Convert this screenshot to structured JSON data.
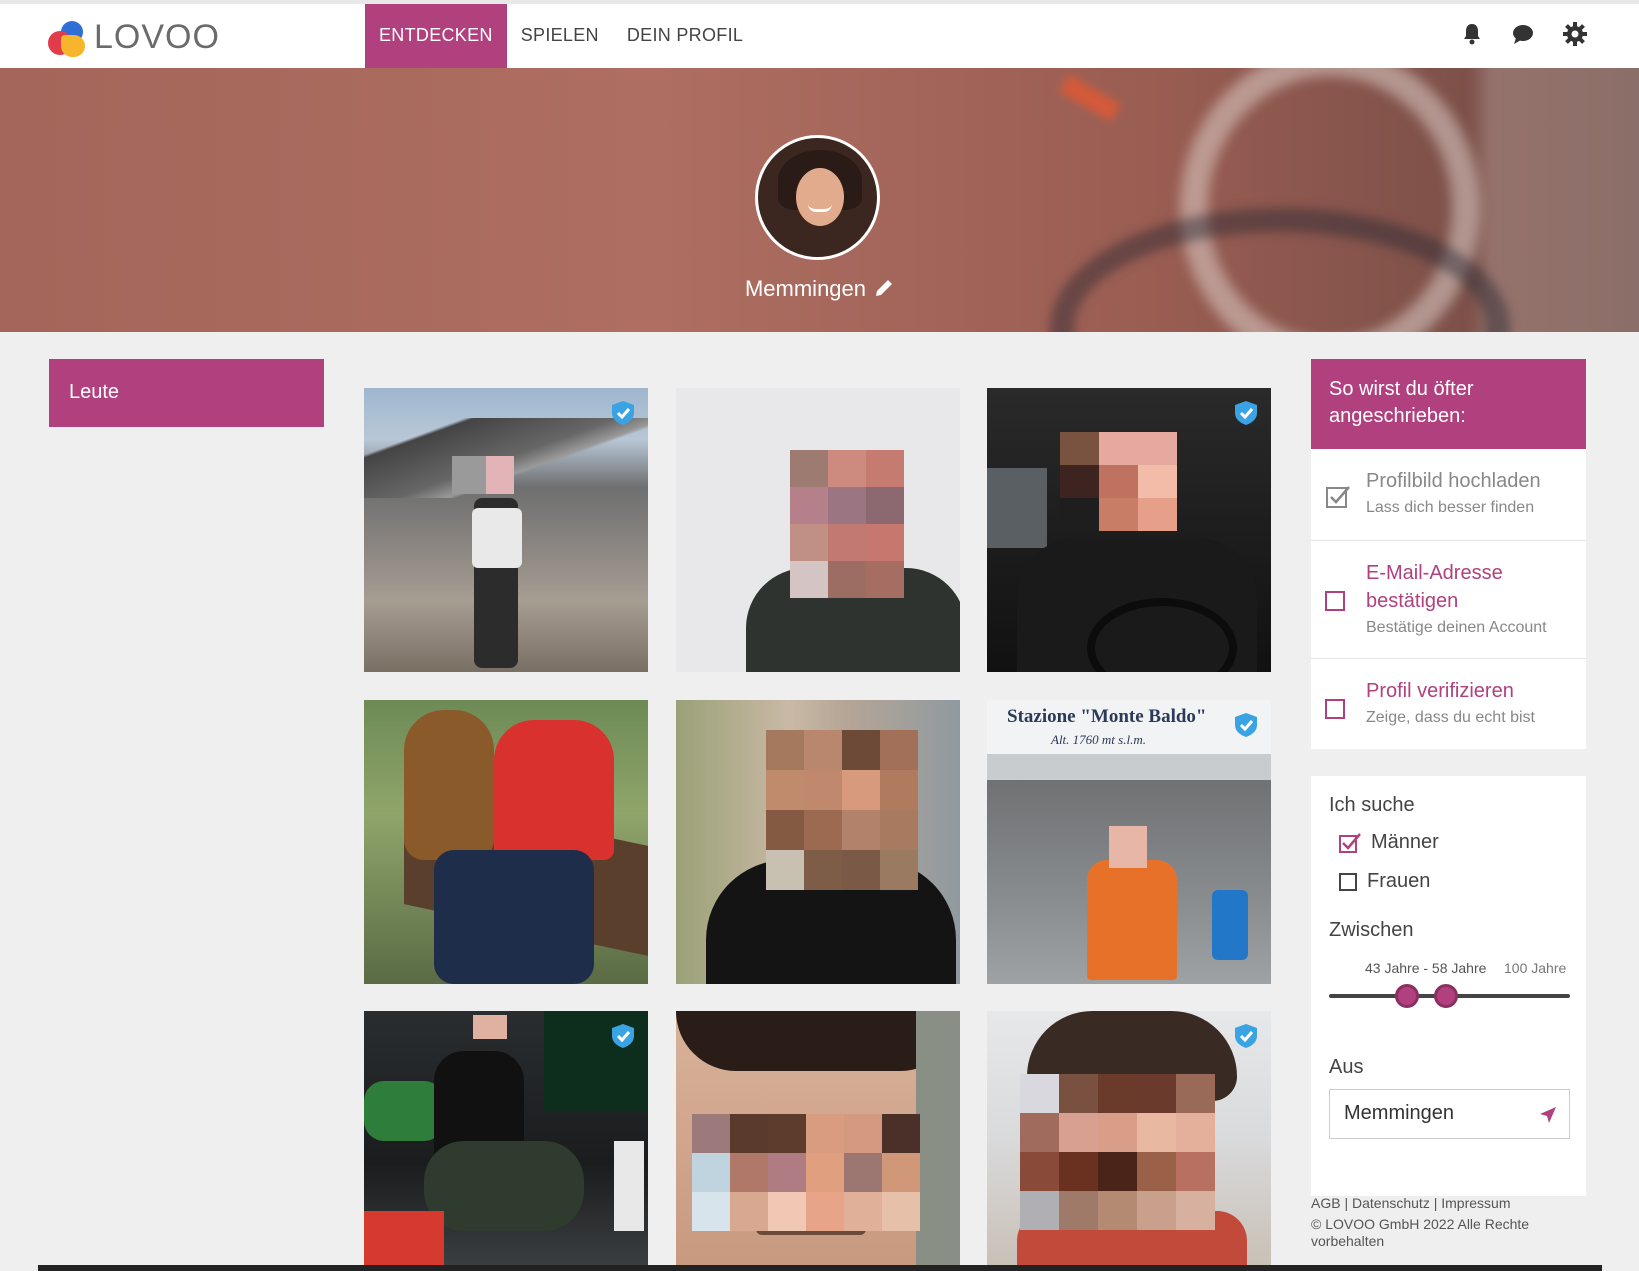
{
  "brand": {
    "name": "LOVOO"
  },
  "nav": {
    "items": [
      {
        "label": "ENTDECKEN",
        "active": true
      },
      {
        "label": "SPIELEN",
        "active": false
      },
      {
        "label": "DEIN PROFIL",
        "active": false
      }
    ]
  },
  "header_icons": [
    "bell-icon",
    "chat-icon",
    "gear-icon"
  ],
  "profile": {
    "city": "Memmingen"
  },
  "left_panel": {
    "title": "Leute"
  },
  "colors": {
    "accent": "#b0407e",
    "verified": "#3aa3e3"
  },
  "grid": {
    "tiles": [
      {
        "verified": true
      },
      {
        "verified": false
      },
      {
        "verified": true
      },
      {
        "verified": false
      },
      {
        "verified": false
      },
      {
        "verified": true,
        "sign_line1": "Stazione \"Monte Baldo\"",
        "sign_line2": "Alt. 1760 mt s.l.m."
      },
      {
        "verified": true
      },
      {
        "verified": false
      },
      {
        "verified": true
      }
    ]
  },
  "tips": {
    "heading": "So wirst du öfter angeschrieben:",
    "items": [
      {
        "title": "Profilbild hochladen",
        "subtitle": "Lass dich besser finden",
        "done": true
      },
      {
        "title": "E-Mail-Adresse bestätigen",
        "subtitle": "Bestätige deinen Account",
        "done": false
      },
      {
        "title": "Profil verifizieren",
        "subtitle": "Zeige, dass du echt bist",
        "done": false
      }
    ]
  },
  "search": {
    "looking_for_label": "Ich suche",
    "options": [
      {
        "label": "Männer",
        "checked": true
      },
      {
        "label": "Frauen",
        "checked": false
      }
    ],
    "age_label": "Zwischen",
    "age_range_text": "43 Jahre - 58 Jahre",
    "age_max_text": "100 Jahre",
    "age_min": 43,
    "age_max": 58,
    "from_label": "Aus",
    "from_value": "Memmingen"
  },
  "footer": {
    "links": [
      "AGB",
      "Datenschutz",
      "Impressum"
    ],
    "separator": " | ",
    "copyright": "© LOVOO GmbH 2022 Alle Rechte vorbehalten"
  }
}
